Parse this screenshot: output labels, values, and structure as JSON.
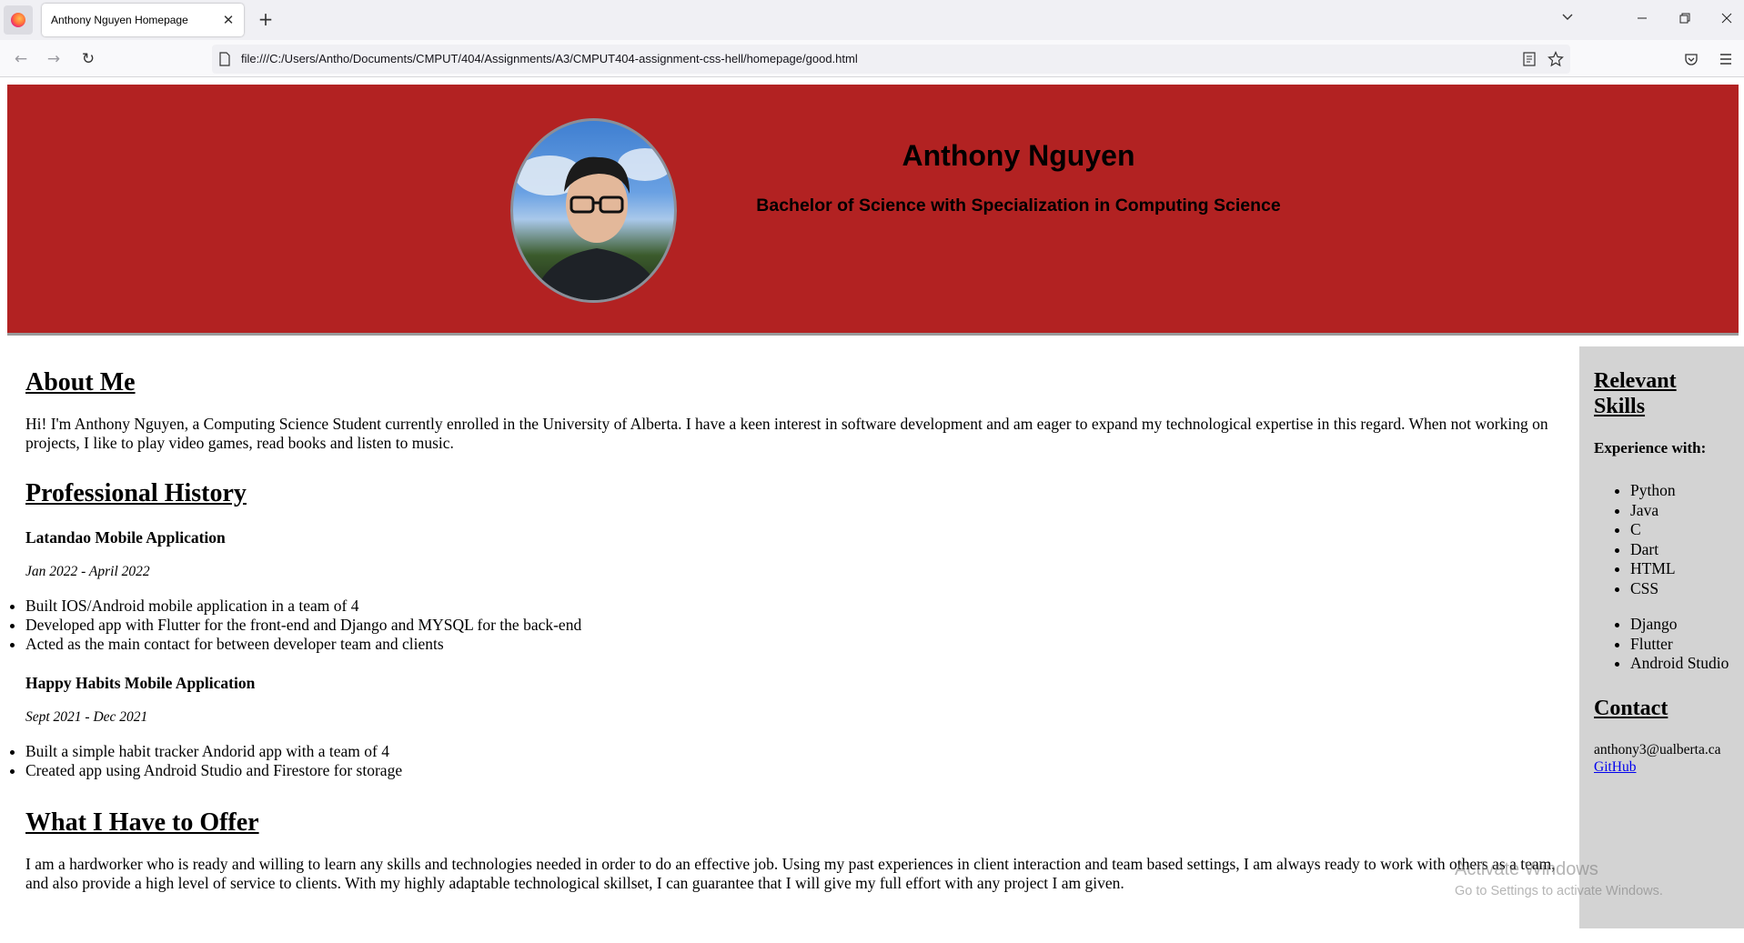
{
  "browser": {
    "tab_title": "Anthony Nguyen Homepage",
    "tab_close": "✕",
    "new_tab": "+",
    "url": "file:///C:/Users/Antho/Documents/CMPUT/404/Assignments/A3/CMPUT404-assignment-css-hell/homepage/good.html",
    "icons": [
      "firefox-icon",
      "chevron-down-icon",
      "minimize-icon",
      "restore-icon",
      "close-icon",
      "back-icon",
      "forward-icon",
      "reload-icon",
      "page-icon",
      "reader-view-icon",
      "bookmark-star-icon",
      "pocket-icon",
      "menu-icon"
    ]
  },
  "header": {
    "name": "Anthony Nguyen",
    "degree": "Bachelor of Science with Specialization in Computing Science"
  },
  "about": {
    "heading": "About Me",
    "text": "Hi! I'm Anthony Nguyen, a Computing Science Student currently enrolled in the University of Alberta. I have a keen interest in software development and am eager to expand my technological expertise in this regard. When not working on projects, I like to play video games, read books and listen to music."
  },
  "history": {
    "heading": "Professional History",
    "jobs": [
      {
        "title": "Latandao Mobile Application",
        "dates": "Jan 2022 - April 2022",
        "duties": [
          "Built IOS/Android mobile application in a team of 4",
          "Developed app with Flutter for the front-end and Django and MYSQL for the back-end",
          "Acted as the main contact for between developer team and clients"
        ]
      },
      {
        "title": "Happy Habits Mobile Application",
        "dates": "Sept 2021 - Dec 2021",
        "duties": [
          "Built a simple habit tracker Andorid app with a team of 4",
          "Created app using Android Studio and Firestore for storage"
        ]
      }
    ]
  },
  "offer": {
    "heading": "What I Have to Offer",
    "text": "I am a hardworker who is ready and willing to learn any skills and technologies needed in order to do an effective job. Using my past experiences in client interaction and team based settings, I am always ready to work with others as a team, and also provide a high level of service to clients. With my highly adaptable technological skillset, I can guarantee that I will give my full effort with any project I am given."
  },
  "sidebar": {
    "skills_heading": "Relevant Skills",
    "experience_label": "Experience with:",
    "languages": [
      "Python",
      "Java",
      "C",
      "Dart",
      "HTML",
      "CSS"
    ],
    "frameworks": [
      "Django",
      "Flutter",
      "Android Studio"
    ],
    "contact_heading": "Contact",
    "email": "anthony3@ualberta.ca",
    "github": "GitHub"
  },
  "watermark": {
    "line1": "Activate Windows",
    "line2": "Go to Settings to activate Windows."
  }
}
